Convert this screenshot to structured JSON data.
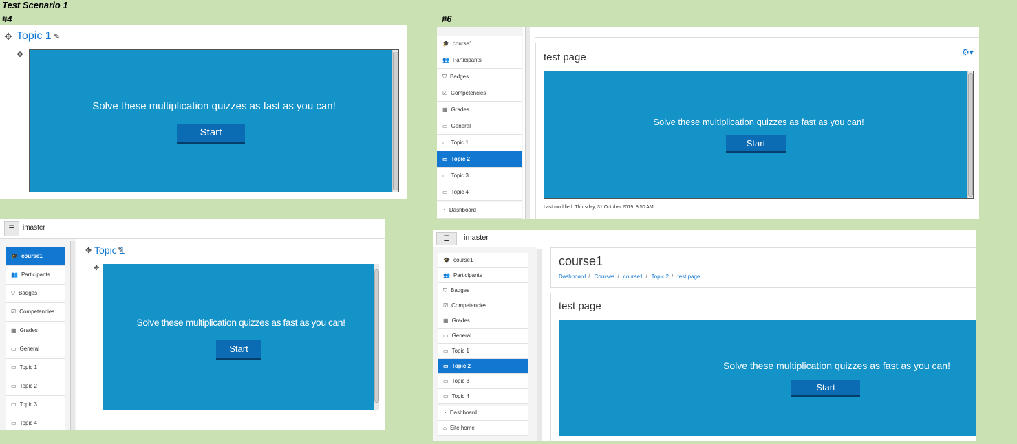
{
  "scenario_title": "Test Scenario 1",
  "labels": {
    "p4": "#4",
    "p6": "#6"
  },
  "quiz": {
    "message": "Solve these multiplication quizzes as fast as you can!",
    "start_label": "Start"
  },
  "topic_heading": "Topic 1",
  "header": {
    "username": "imaster"
  },
  "course": {
    "title": "course1",
    "breadcrumb": [
      "Dashboard",
      "Courses",
      "course1",
      "Topic 2",
      "test page"
    ]
  },
  "page_title": "test page",
  "last_modified": "Last modified: Thursday, 31 October 2019, 8:50 AM",
  "nav": {
    "course1": "course1",
    "participants": "Participants",
    "badges": "Badges",
    "competencies": "Competencies",
    "grades": "Grades",
    "general": "General",
    "topic1": "Topic 1",
    "topic2": "Topic 2",
    "topic3": "Topic 3",
    "topic4": "Topic 4",
    "dashboard": "Dashboard",
    "site_home": "Site home"
  },
  "colors": {
    "background": "#c9e1b3",
    "quiz_bg": "#1493c9",
    "accent": "#1177d1",
    "start_btn": "#0b6cb3"
  }
}
